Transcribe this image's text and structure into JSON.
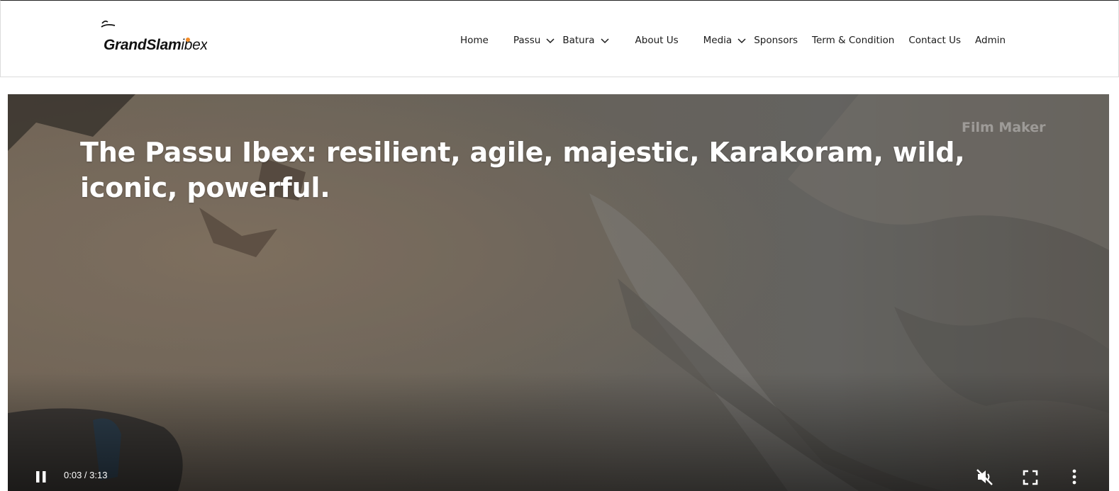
{
  "brand": {
    "logo_text_bold": "GrandSlam",
    "logo_text_light": "ibex",
    "accent_color": "#f28c28"
  },
  "nav": {
    "items": [
      {
        "label": "Home",
        "has_dropdown": false
      },
      {
        "label": "Passu",
        "has_dropdown": true
      },
      {
        "label": "Batura",
        "has_dropdown": true
      },
      {
        "label": "About Us",
        "has_dropdown": false
      },
      {
        "label": "Media",
        "has_dropdown": true
      },
      {
        "label": "Sponsors",
        "has_dropdown": false
      },
      {
        "label": "Term & Condition",
        "has_dropdown": false
      },
      {
        "label": "Contact Us",
        "has_dropdown": false
      },
      {
        "label": "Admin",
        "has_dropdown": false
      }
    ]
  },
  "hero": {
    "title": "The Passu Ibex: resilient, agile, majestic, Karakoram, wild, iconic, powerful.",
    "watermark": "Film Maker"
  },
  "video": {
    "current_time": "0:03",
    "duration": "3:13",
    "time_display": "0:03 / 3:13",
    "state": "playing",
    "muted": true,
    "icons": [
      "pause-icon",
      "mute-icon",
      "fullscreen-icon",
      "more-options-icon"
    ]
  }
}
